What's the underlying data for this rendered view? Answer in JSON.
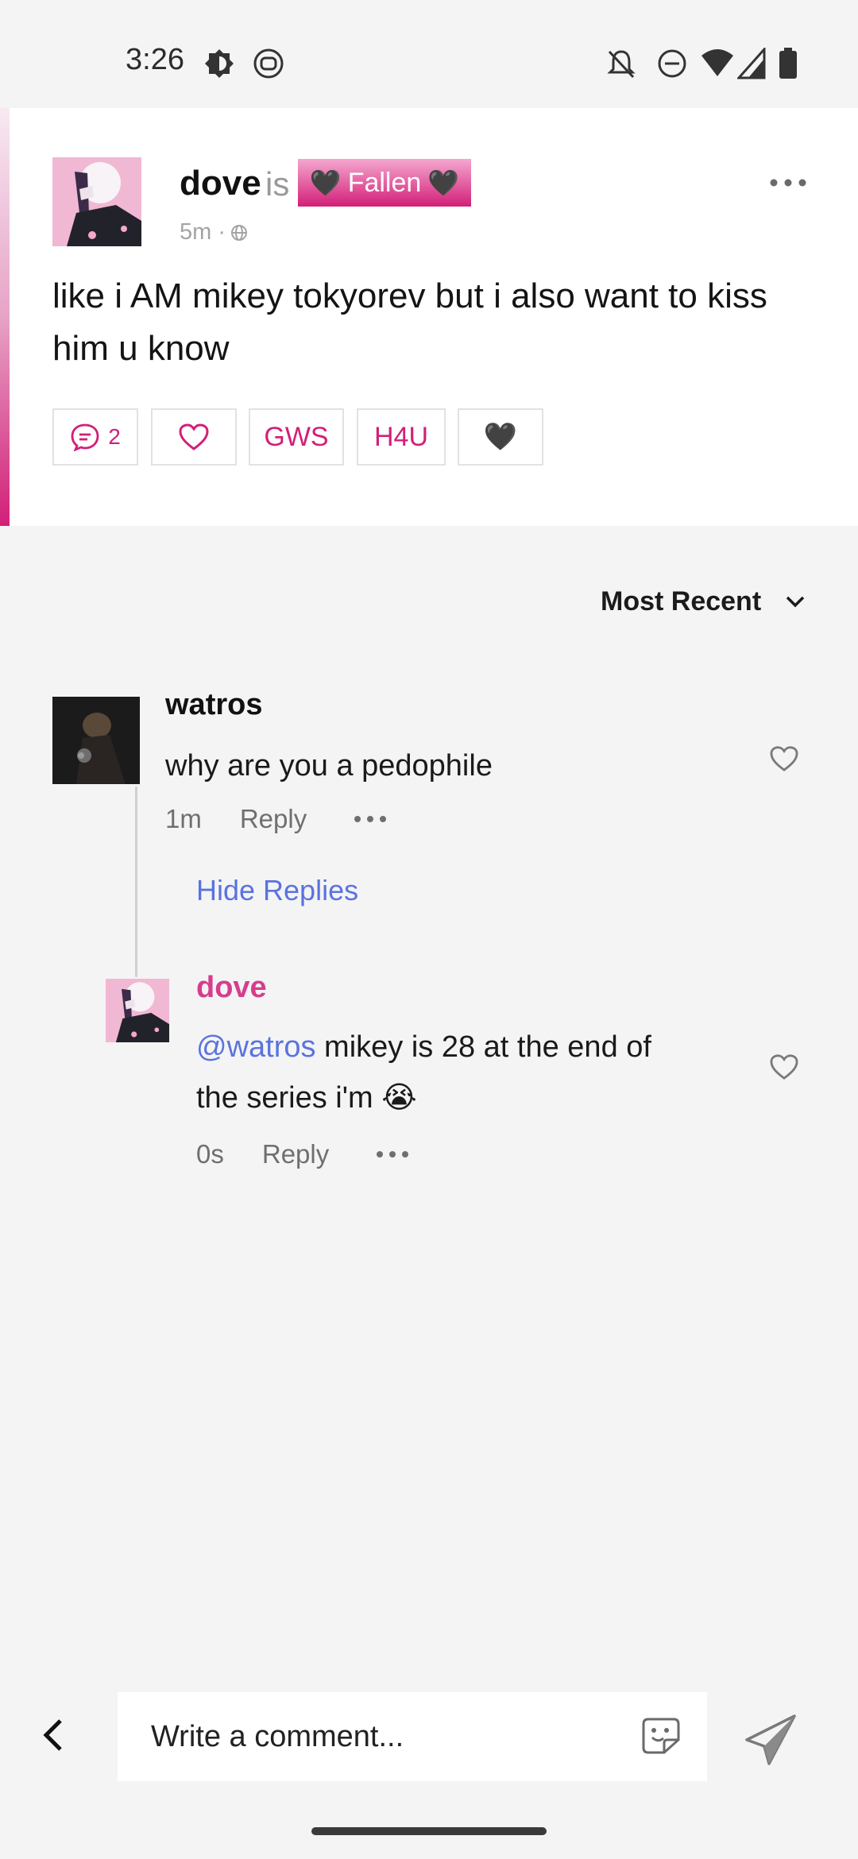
{
  "status_bar": {
    "time": "3:26",
    "icons": [
      "brightness-icon",
      "assistant-icon",
      "notifications-off-icon",
      "do-not-disturb-icon",
      "wifi-icon",
      "signal-icon",
      "battery-icon"
    ]
  },
  "post": {
    "author": "dove",
    "is_text": "is",
    "mood": {
      "label": "Fallen",
      "heart": "🖤"
    },
    "time": "5m ·",
    "visibility_icon": "globe-icon",
    "text": "like i AM mikey tokyorev but i also want to kiss him u know",
    "reactions": [
      {
        "name": "comments",
        "count": "2"
      },
      {
        "name": "like"
      },
      {
        "name": "gws",
        "label": "GWS"
      },
      {
        "name": "h4u",
        "label": "H4U"
      },
      {
        "name": "black-heart",
        "label": "🖤"
      }
    ]
  },
  "sort": {
    "label": "Most Recent"
  },
  "comments": [
    {
      "author": "watros",
      "text": "why are you a pedophile",
      "time": "1m",
      "reply_label": "Reply",
      "hide_replies_label": "Hide Replies",
      "replies": [
        {
          "author": "dove",
          "mention": "@watros",
          "text": " mikey is 28 at the end of the series i'm 😭",
          "time": "0s",
          "reply_label": "Reply"
        }
      ]
    }
  ],
  "composer": {
    "placeholder": "Write a comment..."
  },
  "colors": {
    "accent": "#d21f78",
    "link": "#5a73e0",
    "background": "#f4f4f4"
  }
}
